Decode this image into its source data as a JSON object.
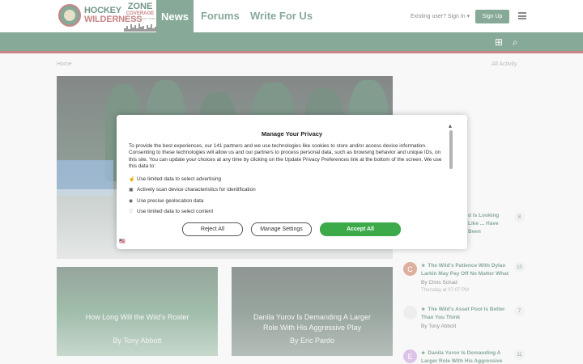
{
  "header": {
    "logo_line1": "HOCKEY",
    "logo_line2": "WILDERNESS",
    "zone_title": "ZONE",
    "zone_sub": "COVERAGE",
    "zone_tag": "NEW YORK · YOUR TEAMS",
    "nav": [
      "News",
      "Forums",
      "Write For Us"
    ],
    "signin": "Existing user? Sign In ▾",
    "signup": "Sign Up"
  },
  "subbar": {
    "icon1": "⊞",
    "icon2": "⌕"
  },
  "main": {
    "breadcrumb": "Home",
    "all_activity": "All Activity",
    "cards": [
      {
        "title": "How Long Will the Wild's Roster",
        "author": "By Tony Abbott"
      },
      {
        "title": "Danila Yurov Is Demanding A Larger Role With His Aggressive Play",
        "author": "By Eric Pardo"
      }
    ]
  },
  "sidebar": [
    {
      "title_tail": "d Is Looking Like ... Have Been",
      "line2": "Have Been",
      "count": "8",
      "avatar": "#bdbdbd"
    },
    {
      "title": "The Wild's Patience With Dylan Larkin May Pay Off No Matter What",
      "by": "By Chris Schad",
      "time": "Thursday at 07:07 PM",
      "count": "10",
      "avatar": "#c5755a",
      "avatar_letter": "C"
    },
    {
      "title": "The Wild's Asset Pool Is Better Than You Think",
      "by": "By Tony Abbott",
      "count": "7",
      "avatar": "#e0e0e0"
    },
    {
      "title": "Danila Yurov Is Demanding A Larger Role With His Aggressive",
      "count": "11",
      "avatar": "#c39ad9",
      "avatar_letter": "E"
    }
  ],
  "modal": {
    "title": "Manage Your Privacy",
    "close": "▴",
    "intro": "To provide the best experiences, our 141 partners and we use technologies like cookies to store and/or access device information. Consenting to these technologies will allow us and our partners to process personal data, such as browsing behavior and unique IDs, on this site. You can update your choices at any time by clicking on the Update Privacy Preferences link at the bottom of the screen. We use this data to:",
    "purposes": [
      {
        "icon": "☝",
        "label": "Use limited data to select advertising"
      },
      {
        "icon": "▣",
        "label": "Actively scan device characteristics for identification"
      },
      {
        "icon": "◉",
        "label": "Use precise geolocation data"
      },
      {
        "icon": "♡",
        "label": "Use limited data to select content"
      }
    ],
    "reject": "Reject All",
    "manage": "Manage Settings",
    "accept": "Accept All",
    "flag": "🇺🇸"
  },
  "colors": {
    "brand_green": "#2f6b4f",
    "brand_red": "#a32b2f",
    "accept_green": "#3daa4a"
  }
}
